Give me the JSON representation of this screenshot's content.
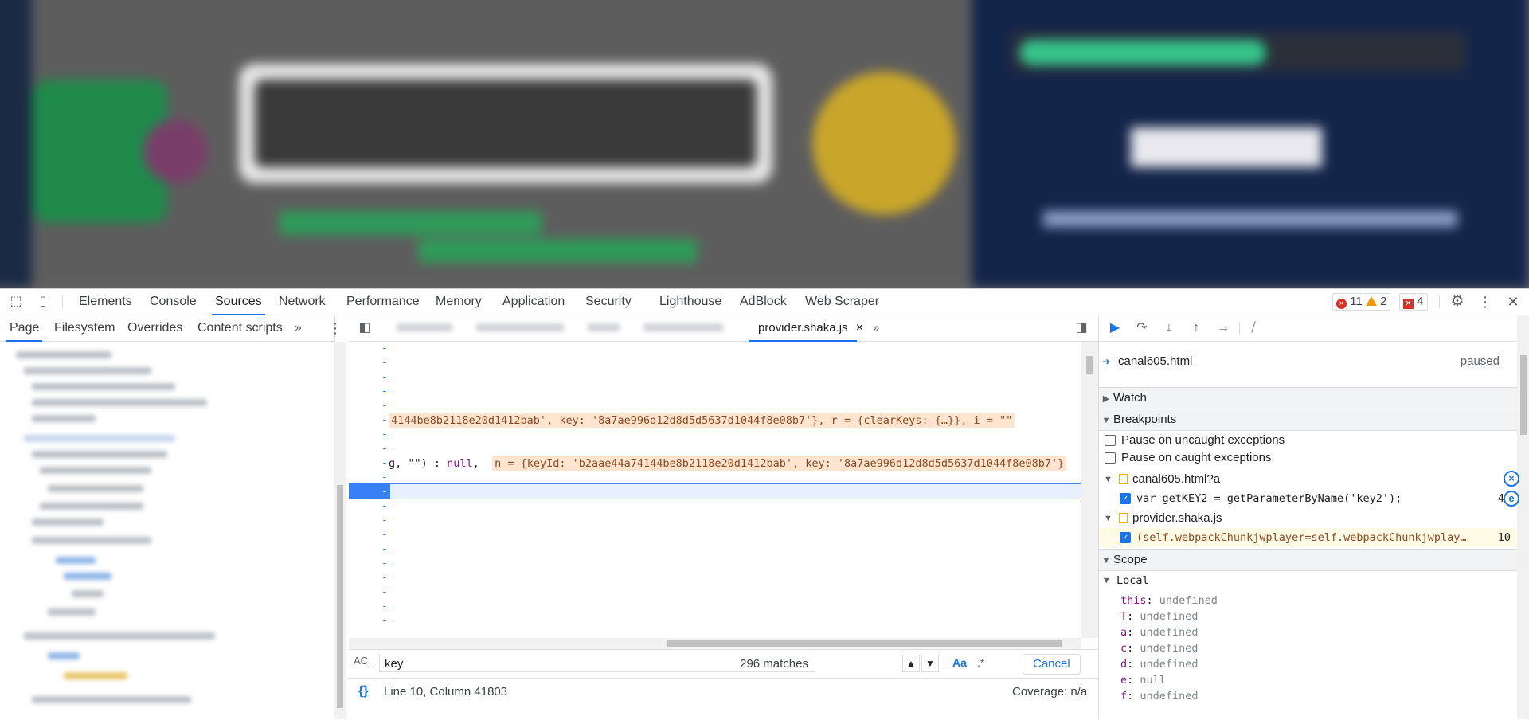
{
  "main_tabs": [
    "Elements",
    "Console",
    "Sources",
    "Network",
    "Performance",
    "Memory",
    "Application",
    "Security",
    "Lighthouse",
    "AdBlock",
    "Web Scraper"
  ],
  "overflow_glyph": "»",
  "issues": {
    "errors": "11",
    "warnings": "2",
    "issues": "4"
  },
  "navigator": {
    "tabs": [
      "Page",
      "Filesystem",
      "Overrides",
      "Content scripts"
    ]
  },
  "editor": {
    "open_file": "provider.shaka.js",
    "close_glyph": "×",
    "dash": "-",
    "line_a_prefix": "4144be8b2118e20d1412bab', key: '8a7ae996d12d8d5d5637d1044f8e08b7'}, r = {clearKeys: {…}}, i = \"\"",
    "line_b_prefix": "g, \"\") : ",
    "line_b_null": "null",
    "line_b_comma": ",",
    "line_b_value": "n = {keyId: 'b2aae44a74144be8b2118e20d1412bab', key: '8a7ae996d12d8d5d5637d1044f8e08b7'}"
  },
  "search": {
    "label_icon": "A͟C͟",
    "query": "key",
    "matches": "296 matches",
    "case_button": "Aa",
    "regex_button": ".*",
    "cancel": "Cancel"
  },
  "status": {
    "braces": "{}",
    "position": "Line 10, Column 41803",
    "coverage": "Coverage: n/a"
  },
  "debugger": {
    "call_stack": {
      "file": "canal605.html",
      "state": "paused"
    },
    "sections": {
      "watch": "Watch",
      "breakpoints": "Breakpoints",
      "scope": "Scope",
      "local": "Local"
    },
    "pause_uncaught": "Pause on uncaught exceptions",
    "pause_caught": "Pause on caught exceptions",
    "bp_groups": [
      {
        "file": "canal605.html?a",
        "code": "var getKEY2 = getParameterByName('key2');",
        "line": "43"
      },
      {
        "file": "provider.shaka.js",
        "code": "(self.webpackChunkjwplayer=self.webpackChunkjwplay…",
        "line": "10"
      }
    ],
    "scope_vars": [
      {
        "k": "this",
        "v": "undefined"
      },
      {
        "k": "T",
        "v": "undefined"
      },
      {
        "k": "a",
        "v": "undefined"
      },
      {
        "k": "c",
        "v": "undefined"
      },
      {
        "k": "d",
        "v": "undefined"
      },
      {
        "k": "e",
        "v": "null"
      },
      {
        "k": "f",
        "v": "undefined"
      }
    ]
  },
  "colors": {
    "accent": "#1a73e8",
    "error": "#d93025",
    "warning": "#f29900",
    "inline_value_bg": "#ffe5cf"
  }
}
